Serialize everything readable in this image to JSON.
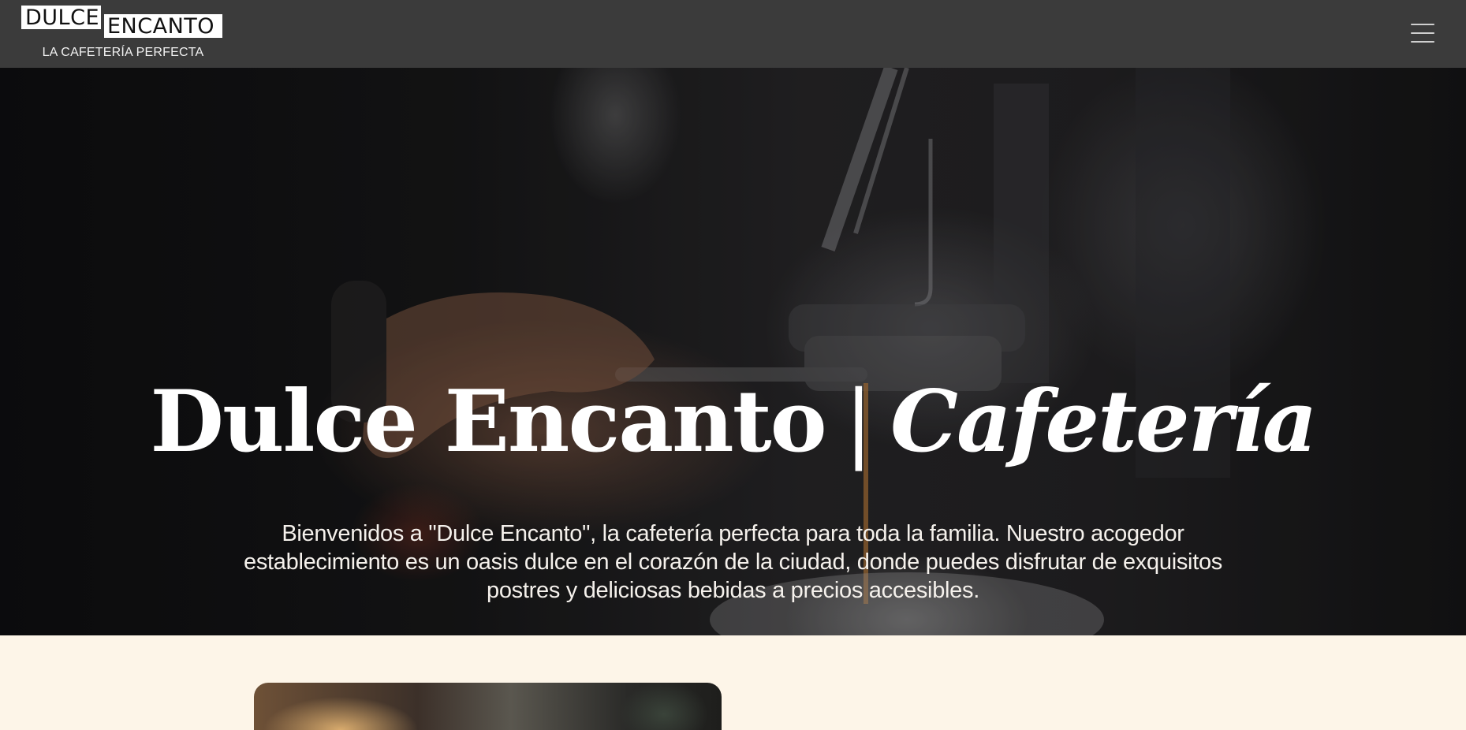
{
  "brand": {
    "logo_word1": "DULCE",
    "logo_word2": "ENCANTO",
    "tagline": "LA CAFETERÍA PERFECTA"
  },
  "nav": {
    "menu_icon": "hamburger-menu-icon"
  },
  "hero": {
    "title_main": "Dulce Encanto",
    "title_separator": "|",
    "title_italic": "Cafetería",
    "description": "Bienvenidos a \"Dulce Encanto\", la cafetería perfecta para toda la familia. Nuestro acogedor establecimiento es un oasis dulce en el corazón de la ciudad, donde puedes disfrutar de exquisitos postres y deliciosas bebidas a precios accesibles.",
    "background_image": "espresso machine pouring coffee photo"
  },
  "next_section": {
    "image": "cafe interior photo"
  },
  "colors": {
    "navbar": "#3b3b3b",
    "page_background": "#fdf5e8",
    "hero_text": "#ffffff",
    "menu_icon": "#cfcfcf"
  }
}
